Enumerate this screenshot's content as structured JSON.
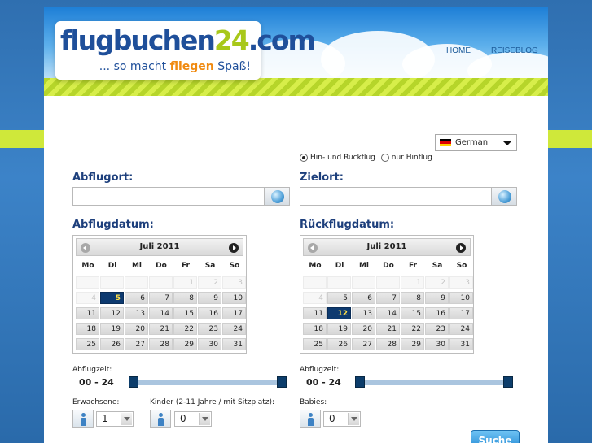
{
  "brand": {
    "name_part1": "flugbuchen",
    "name_part2": "24",
    "name_part3": ".com",
    "tagline_pre": "... so macht ",
    "tagline_hl": "fliegen",
    "tagline_post": " Spaß!"
  },
  "nav": {
    "home": "HOME",
    "blog": "REISEBLOG"
  },
  "language": {
    "selected": "German",
    "flag_icon": "german-flag-icon"
  },
  "trip_type": {
    "round_trip": "Hin- und Rückflug",
    "one_way": "nur Hinflug",
    "selected": "round_trip"
  },
  "origin": {
    "label": "Abflugort:",
    "value": ""
  },
  "destination": {
    "label": "Zielort:",
    "value": ""
  },
  "calendar_departure": {
    "label": "Abflugdatum:",
    "month": "Juli 2011",
    "selected": "5"
  },
  "calendar_return": {
    "label": "Rückflugdatum:",
    "month": "Juli 2011",
    "selected": "12"
  },
  "weekdays": [
    "Mo",
    "Di",
    "Mi",
    "Do",
    "Fr",
    "Sa",
    "So"
  ],
  "calendar_weeks": [
    [
      "",
      "",
      "",
      "",
      "1",
      "2",
      "3"
    ],
    [
      "4",
      "5",
      "6",
      "7",
      "8",
      "9",
      "10"
    ],
    [
      "11",
      "12",
      "13",
      "14",
      "15",
      "16",
      "17"
    ],
    [
      "18",
      "19",
      "20",
      "21",
      "22",
      "23",
      "24"
    ],
    [
      "25",
      "26",
      "27",
      "28",
      "29",
      "30",
      "31"
    ]
  ],
  "departure_time": {
    "label": "Abflugzeit:",
    "value": "00 - 24",
    "range": [
      0,
      24
    ]
  },
  "return_time": {
    "label": "Abflugzeit:",
    "value": "00 - 24",
    "range": [
      0,
      24
    ]
  },
  "passengers": {
    "adults_label": "Erwachsene:",
    "adults": "1",
    "children_label": "Kinder (2-11 Jahre / mit Sitzplatz):",
    "children": "0",
    "babies_label": "Babies:",
    "babies": "0"
  },
  "search_button": "Suche",
  "colors": {
    "accent_green": "#cfe83a",
    "navy": "#0d3a70",
    "selected_text": "#ffe14a",
    "button_blue": "#1f86d2"
  }
}
